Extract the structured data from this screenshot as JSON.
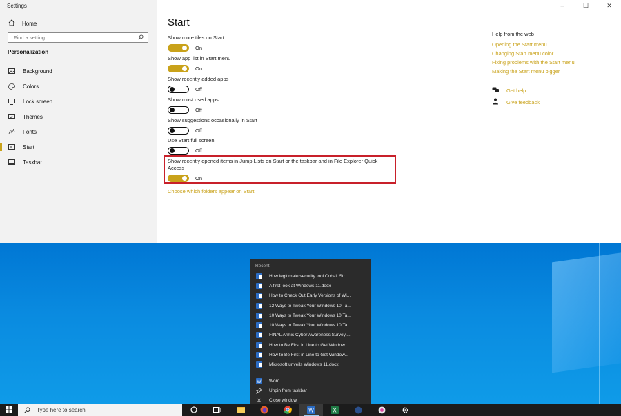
{
  "window": {
    "title": "Settings",
    "controls": [
      "minimize",
      "maximize",
      "close"
    ]
  },
  "sidebar": {
    "home": "Home",
    "search_placeholder": "Find a setting",
    "section": "Personalization",
    "items": [
      {
        "label": "Background",
        "icon": "picture-icon"
      },
      {
        "label": "Colors",
        "icon": "palette-icon"
      },
      {
        "label": "Lock screen",
        "icon": "monitor-icon"
      },
      {
        "label": "Themes",
        "icon": "brush-icon"
      },
      {
        "label": "Fonts",
        "icon": "font-icon"
      },
      {
        "label": "Start",
        "icon": "start-icon"
      },
      {
        "label": "Taskbar",
        "icon": "taskbar-icon"
      }
    ],
    "active_item": "Start"
  },
  "main": {
    "title": "Start",
    "settings": [
      {
        "label": "Show more tiles on Start",
        "state": "On"
      },
      {
        "label": "Show app list in Start menu",
        "state": "On"
      },
      {
        "label": "Show recently added apps",
        "state": "Off"
      },
      {
        "label": "Show most used apps",
        "state": "Off"
      },
      {
        "label": "Show suggestions occasionally in Start",
        "state": "Off"
      },
      {
        "label": "Use Start full screen",
        "state": "Off"
      },
      {
        "label": "Show recently opened items in Jump Lists on Start or the taskbar and in File Explorer Quick Access",
        "state": "On"
      }
    ],
    "folders_link": "Choose which folders appear on Start"
  },
  "help": {
    "title": "Help from the web",
    "links": [
      "Opening the Start menu",
      "Changing Start menu color",
      "Fixing problems with the Start menu",
      "Making the Start menu bigger"
    ],
    "get_help": "Get help",
    "give_feedback": "Give feedback"
  },
  "jumplist": {
    "header": "Recent",
    "items": [
      "How legitimate security tool Cobalt Str...",
      "A first look at Windows 11.docx",
      "How to Check Out Early Versions of Wi...",
      "12 Ways to Tweak Your Windows 10 Ta...",
      "10 Ways to Tweak Your Windows 10 Ta...",
      "10 Ways to Tweak Your Windows 10 Ta...",
      "FINAL Armis Cyber Awareness Survey....",
      "How to Be First in Line to Get Window...",
      "How to Be First in Line to Get Window...",
      "Microsoft unveils Windows 11.docx"
    ],
    "actions": [
      {
        "label": "Word",
        "icon": "word-icon"
      },
      {
        "label": "Unpin from taskbar",
        "icon": "unpin-icon"
      },
      {
        "label": "Close window",
        "icon": "close-icon"
      }
    ]
  },
  "taskbar": {
    "search_placeholder": "Type here to search",
    "apps": [
      "cortana-icon",
      "task-view-icon",
      "file-explorer-icon",
      "firefox-icon",
      "chrome-icon",
      "word-icon",
      "excel-icon",
      "app-icon",
      "app-icon-2",
      "settings-icon"
    ],
    "active_app": "word-icon"
  },
  "colors": {
    "accent": "#c9a21a",
    "highlight_border": "#c8202a",
    "desktop": "#0a8be0",
    "taskbar": "#1c1c1c",
    "jumplist_bg": "#2b2b2b"
  }
}
